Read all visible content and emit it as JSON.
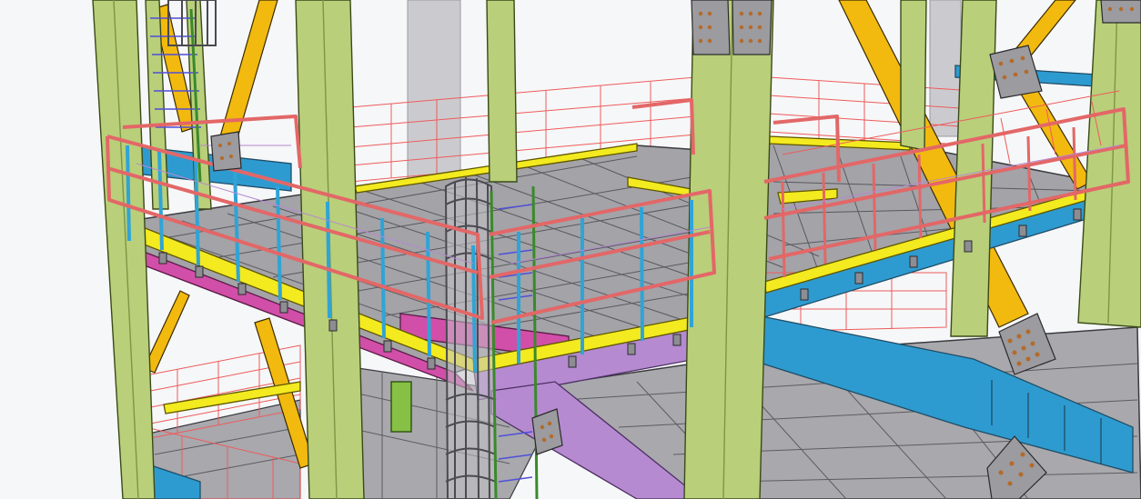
{
  "scene": {
    "subject": "steel-structure-platform",
    "colors": {
      "background": "#f6f7f8",
      "column": "#b9cf7a",
      "column_dark": "#8fa85a",
      "deck": "#a3a3a8",
      "deck_grid": "#58585e",
      "edge_beam": "#f3ea1f",
      "magenta_beam": "#d14fa8",
      "purple_beam": "#b58ad0",
      "blue_beam": "#2e9bd0",
      "brace": "#f2b90f",
      "handrail": "#e36767",
      "post": "#2fa4d6",
      "mesh_rail": "#ef5b5b",
      "ladder": "#4f4fd8",
      "cage": "#8d8d93",
      "pipe": "#cbcbcf",
      "plate": "#9b9ba0",
      "bolt": "#b56a28",
      "outline": "#2b2b2b"
    }
  }
}
